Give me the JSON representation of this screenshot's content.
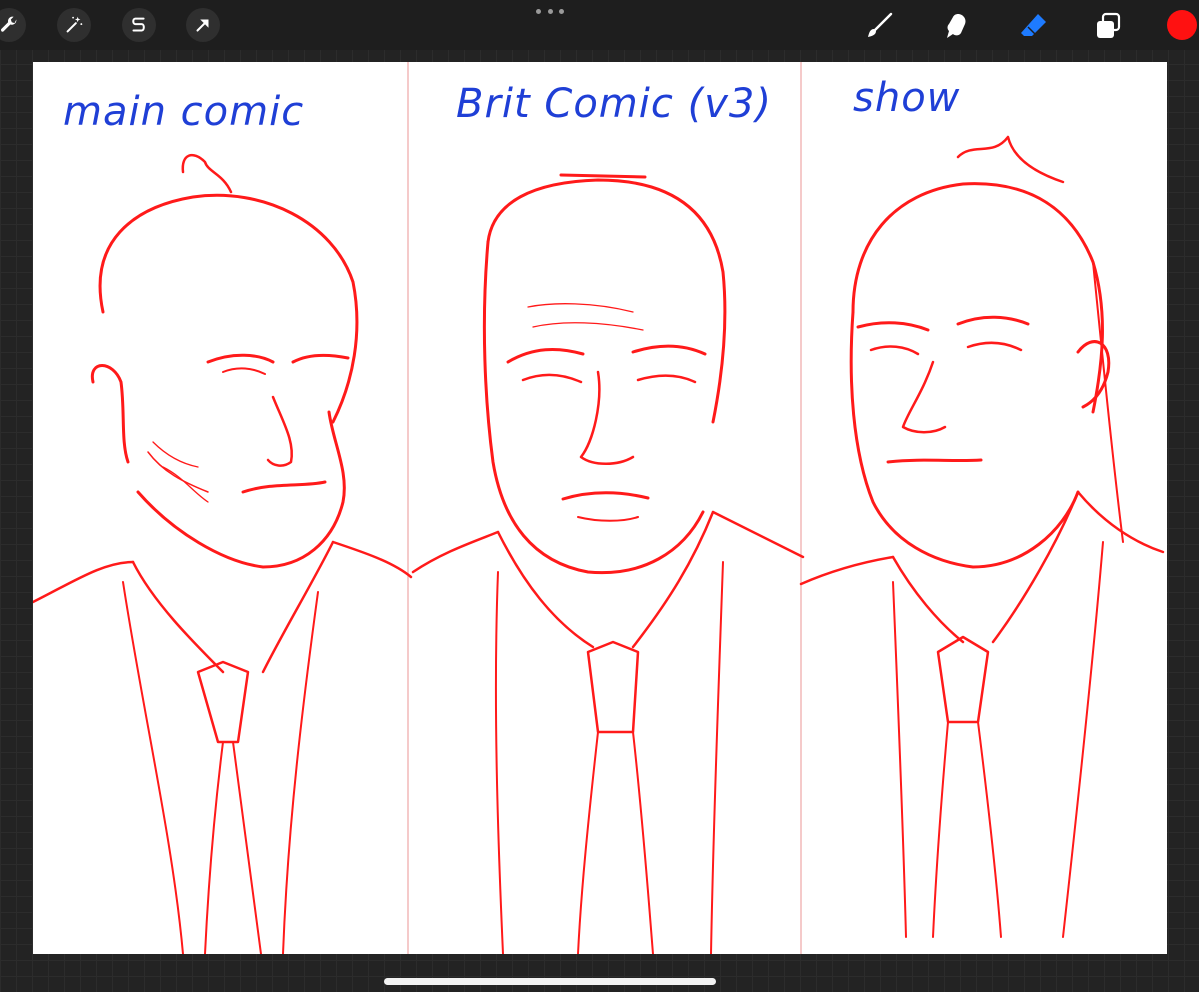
{
  "toolbar": {
    "left_tools": [
      {
        "name": "actions",
        "icon": "wrench-icon"
      },
      {
        "name": "adjustments",
        "icon": "magic-wand-icon"
      },
      {
        "name": "selection",
        "icon": "selection-s-icon"
      },
      {
        "name": "transform",
        "icon": "arrow-cursor-icon"
      }
    ],
    "more_icon": "ellipsis-icon",
    "right_tools": [
      {
        "name": "brush",
        "icon": "brush-icon"
      },
      {
        "name": "smudge",
        "icon": "smudge-icon"
      },
      {
        "name": "eraser",
        "icon": "eraser-icon"
      },
      {
        "name": "layers",
        "icon": "layers-icon"
      }
    ],
    "current_color": "#ff1111",
    "active_tool_color": "#1e7bff",
    "icon_color": "#ffffff"
  },
  "canvas": {
    "background": "#ffffff",
    "sketch_color": "#ff1a1a",
    "label_color": "#1f3fd6",
    "panels": [
      {
        "label": "main comic"
      },
      {
        "label": "Brit Comic (v3)"
      },
      {
        "label": "show"
      }
    ]
  },
  "home_indicator_color": "#f2f2f2"
}
